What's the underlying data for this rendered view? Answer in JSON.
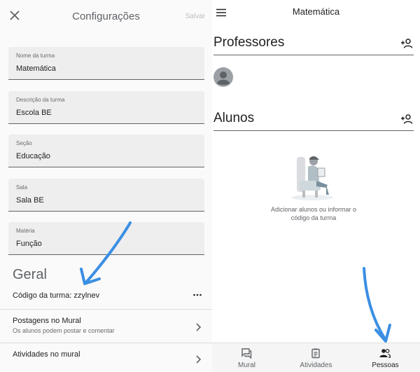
{
  "settings": {
    "title": "Configurações",
    "save_label": "Salvar",
    "fields": [
      {
        "label": "Nome da turma",
        "value": "Matemática"
      },
      {
        "label": "Descrição da turma",
        "value": "Escola BE"
      },
      {
        "label": "Seção",
        "value": "Educação"
      },
      {
        "label": "Sala",
        "value": "Sala BE"
      },
      {
        "label": "Matéria",
        "value": "Função"
      }
    ],
    "general": {
      "heading": "Geral",
      "class_code": "Código da turma: zzylnev",
      "stream_posts_title": "Postagens no Mural",
      "stream_posts_sub": "Os alunos podem postar e comentar",
      "stream_activities_title": "Atividades no mural"
    }
  },
  "people": {
    "class_title": "Matemática",
    "teachers_heading": "Professores",
    "students_heading": "Alunos",
    "empty_message": "Adicionar alunos ou informar o código da turma"
  },
  "bottom_nav": {
    "items": [
      "Mural",
      "Atividades",
      "Pessoas"
    ],
    "active": "Pessoas"
  },
  "colors": {
    "annotation_arrow": "#3b8fe3",
    "field_bg": "#eeeeee",
    "text_dark": "#202124",
    "text_grey": "#5f6368"
  },
  "icons": [
    "close-icon",
    "more-icon",
    "chevron-right-icon",
    "menu-icon",
    "add-person-icon",
    "avatar-icon",
    "stream-icon",
    "classwork-icon",
    "people-icon"
  ]
}
